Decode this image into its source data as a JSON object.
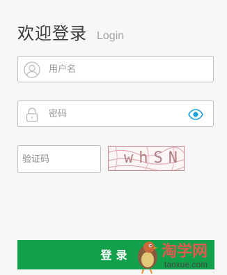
{
  "header": {
    "title_cn": "欢迎登录",
    "title_en": "Login"
  },
  "form": {
    "username": {
      "placeholder": "用户名",
      "icon": "user-icon"
    },
    "password": {
      "placeholder": "密码",
      "icon": "lock-icon",
      "toggle_icon": "eye-icon"
    },
    "captcha": {
      "placeholder": "验证码",
      "image_text": "whSN"
    },
    "submit_label": "登录"
  },
  "watermark": {
    "logo": "bird-logo",
    "text_cn": "淘学网",
    "text_en": "taoxue.com"
  },
  "colors": {
    "accent": "#12a04b",
    "eye_icon": "#1aa3d8",
    "captcha_border": "#c9868b"
  }
}
